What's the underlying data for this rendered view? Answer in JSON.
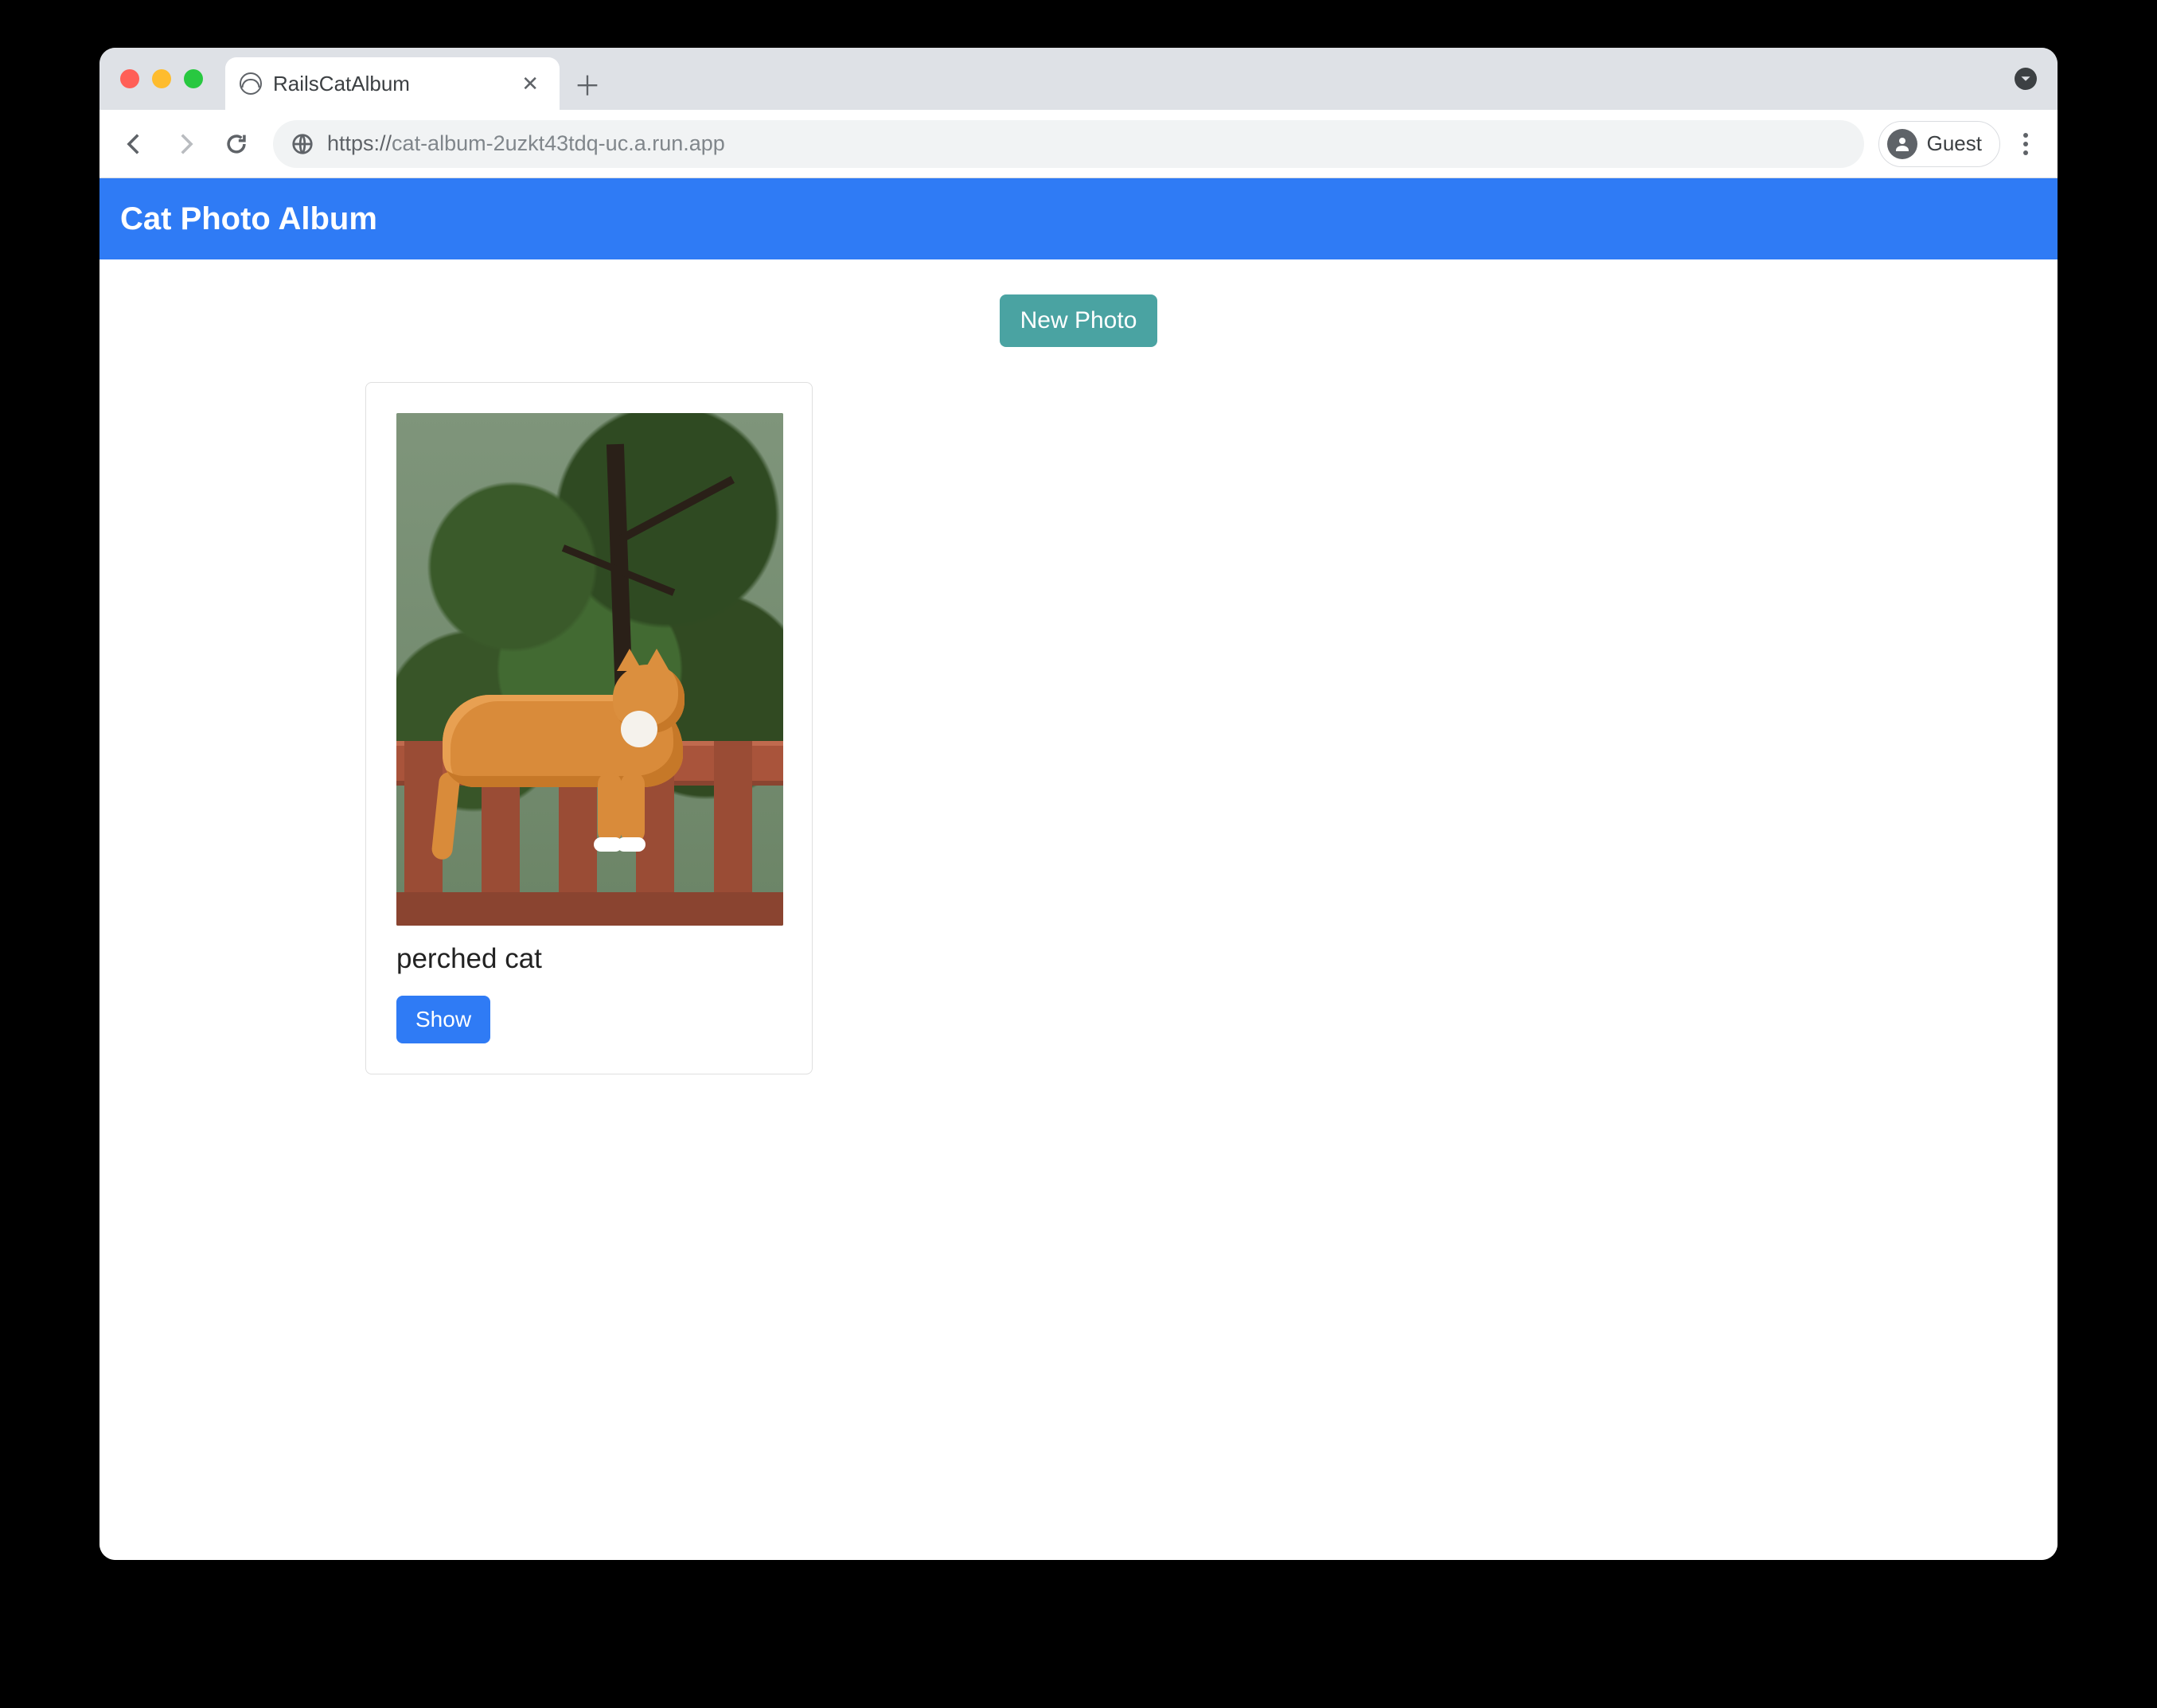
{
  "browser": {
    "tab_title": "RailsCatAlbum",
    "url_scheme": "https://",
    "url_rest": "cat-album-2uzkt43tdq-uc.a.run.app",
    "profile_label": "Guest"
  },
  "app": {
    "header_title": "Cat Photo Album",
    "new_photo_label": "New Photo"
  },
  "photos": [
    {
      "caption": "perched cat",
      "show_label": "Show"
    }
  ]
}
